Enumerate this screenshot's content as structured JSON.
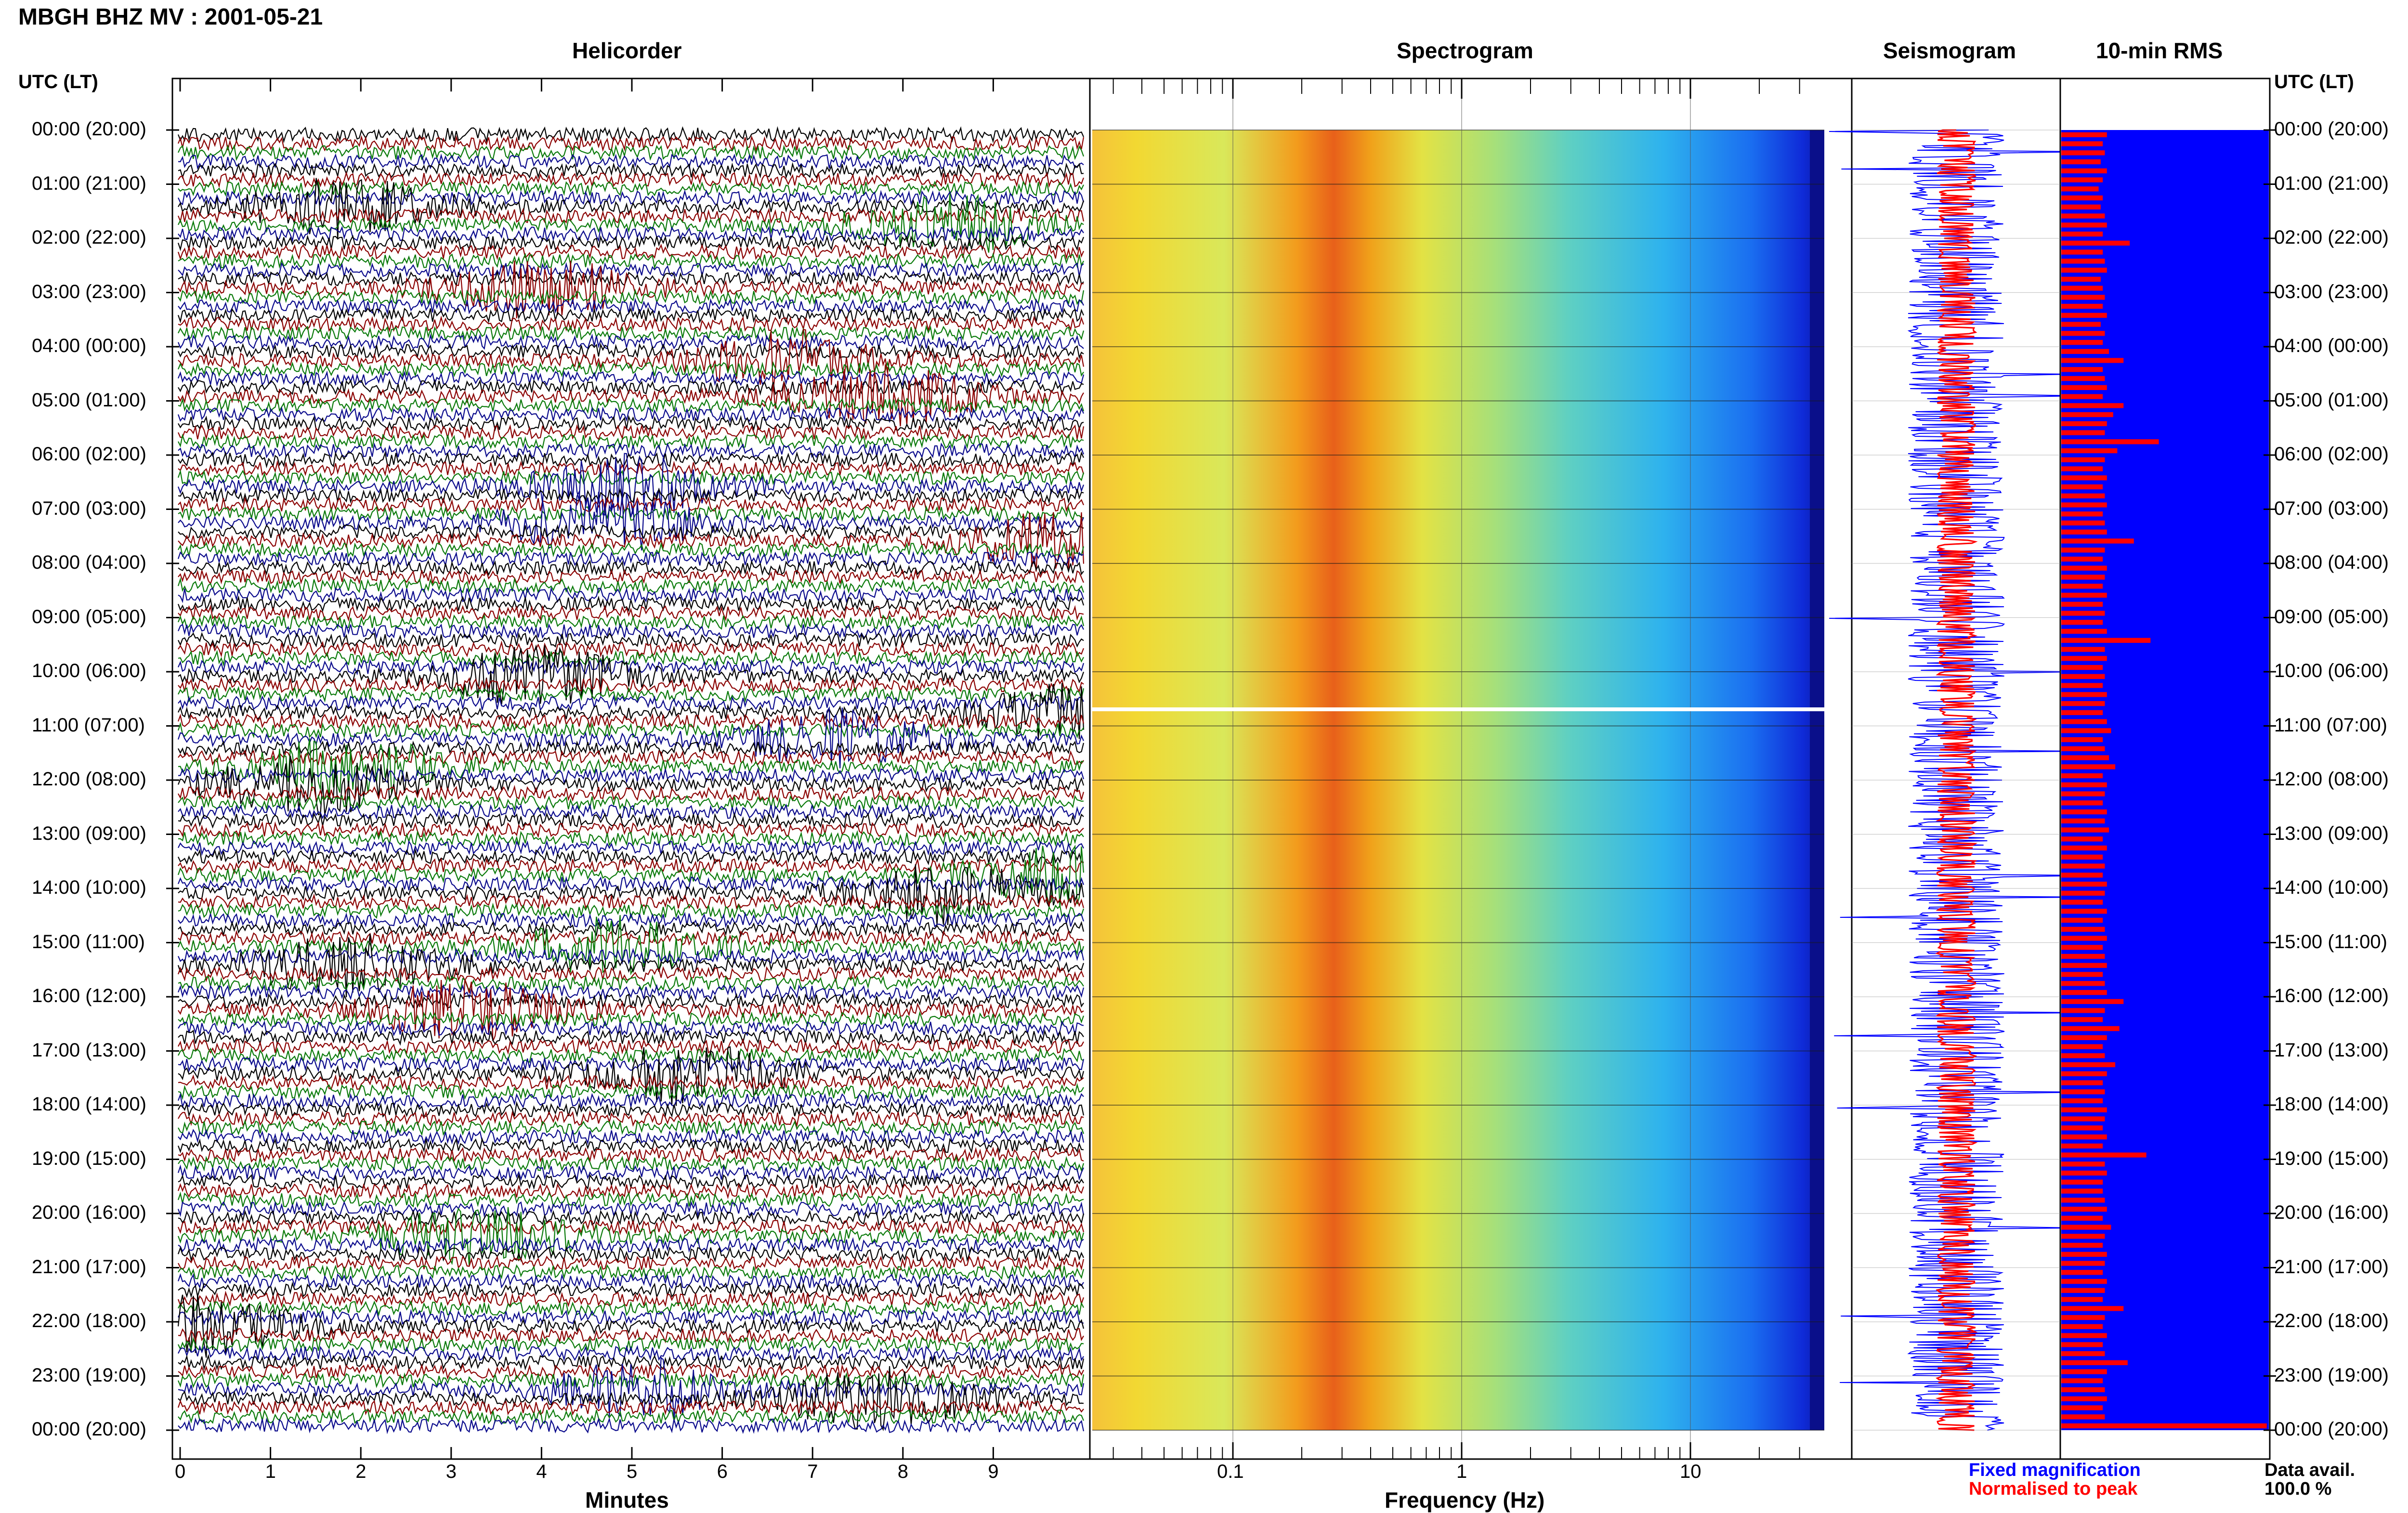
{
  "header": {
    "title": "MBGH BHZ MV : 2001-05-21",
    "utc_label": "UTC (LT)",
    "utc_label_right": "UTC (LT)"
  },
  "panels": {
    "helicorder": "Helicorder",
    "spectrogram": "Spectrogram",
    "seismogram": "Seismogram",
    "rms": "10-min RMS"
  },
  "axes": {
    "minutes_title": "Minutes",
    "frequency_title": "Frequency (Hz)",
    "minutes_ticks": [
      "0",
      "1",
      "2",
      "3",
      "4",
      "5",
      "6",
      "7",
      "8",
      "9"
    ],
    "frequency_ticks": [
      "0.1",
      "1",
      "10"
    ]
  },
  "time_labels": [
    "00:00 (20:00)",
    "01:00 (21:00)",
    "02:00 (22:00)",
    "03:00 (23:00)",
    "04:00 (00:00)",
    "05:00 (01:00)",
    "06:00 (02:00)",
    "07:00 (03:00)",
    "08:00 (04:00)",
    "09:00 (05:00)",
    "10:00 (06:00)",
    "11:00 (07:00)",
    "12:00 (08:00)",
    "13:00 (09:00)",
    "14:00 (10:00)",
    "15:00 (11:00)",
    "16:00 (12:00)",
    "17:00 (13:00)",
    "18:00 (14:00)",
    "19:00 (15:00)",
    "20:00 (16:00)",
    "21:00 (17:00)",
    "22:00 (18:00)",
    "23:00 (19:00)",
    "00:00 (20:00)"
  ],
  "legend": {
    "fixed": "Fixed magnification",
    "normalised": "Normalised to peak",
    "data_avail_label": "Data avail.",
    "data_avail_value": "100.0 %"
  },
  "colors": {
    "trace_cycle": [
      "#000000",
      "#8b0000",
      "#0a7a0a",
      "#0a0a8c"
    ],
    "seismogram_fixed": "#0000ff",
    "seismogram_normalised": "#ff0000",
    "rms_bar": "#ff0000",
    "rms_background": "#0000ff"
  },
  "chart_data": {
    "type": "heatmap",
    "date": "2001-05-21",
    "station": "MBGH BHZ MV",
    "helicorder": {
      "x_unit": "Minutes",
      "x_range": [
        0,
        10
      ],
      "rows": 144,
      "row_minutes": 10
    },
    "spectrogram": {
      "x_scale": "log",
      "x_range_hz": [
        0.02,
        40
      ],
      "peak_band_hz": [
        0.2,
        0.5
      ],
      "data_gap_utc": "10:40"
    },
    "seismogram": {
      "series": [
        "Fixed magnification",
        "Normalised to peak"
      ]
    },
    "rms": {
      "interval_minutes": 10,
      "relative_values": [
        0.22,
        0.2,
        0.21,
        0.19,
        0.22,
        0.2,
        0.18,
        0.2,
        0.19,
        0.21,
        0.22,
        0.2,
        0.33,
        0.2,
        0.21,
        0.22,
        0.19,
        0.2,
        0.21,
        0.2,
        0.22,
        0.19,
        0.21,
        0.2,
        0.23,
        0.3,
        0.2,
        0.21,
        0.22,
        0.2,
        0.3,
        0.25,
        0.22,
        0.21,
        0.47,
        0.27,
        0.21,
        0.2,
        0.22,
        0.2,
        0.21,
        0.22,
        0.2,
        0.21,
        0.22,
        0.35,
        0.21,
        0.2,
        0.22,
        0.21,
        0.2,
        0.22,
        0.2,
        0.21,
        0.2,
        0.22,
        0.43,
        0.21,
        0.22,
        0.2,
        0.21,
        0.2,
        0.22,
        0.21,
        0.2,
        0.22,
        0.24,
        0.2,
        0.21,
        0.23,
        0.26,
        0.2,
        0.22,
        0.21,
        0.2,
        0.22,
        0.21,
        0.23,
        0.2,
        0.22,
        0.2,
        0.21,
        0.2,
        0.22,
        0.21,
        0.2,
        0.22,
        0.2,
        0.21,
        0.22,
        0.2,
        0.21,
        0.22,
        0.2,
        0.21,
        0.22,
        0.3,
        0.21,
        0.2,
        0.28,
        0.22,
        0.2,
        0.21,
        0.26,
        0.22,
        0.2,
        0.21,
        0.2,
        0.22,
        0.21,
        0.2,
        0.22,
        0.2,
        0.41,
        0.21,
        0.22,
        0.2,
        0.2,
        0.21,
        0.22,
        0.2,
        0.24,
        0.21,
        0.2,
        0.22,
        0.21,
        0.2,
        0.22,
        0.21,
        0.2,
        0.3,
        0.21,
        0.2,
        0.22,
        0.2,
        0.21,
        0.32,
        0.22,
        0.2,
        0.21,
        0.22,
        0.2,
        0.21,
        0.99
      ]
    }
  }
}
